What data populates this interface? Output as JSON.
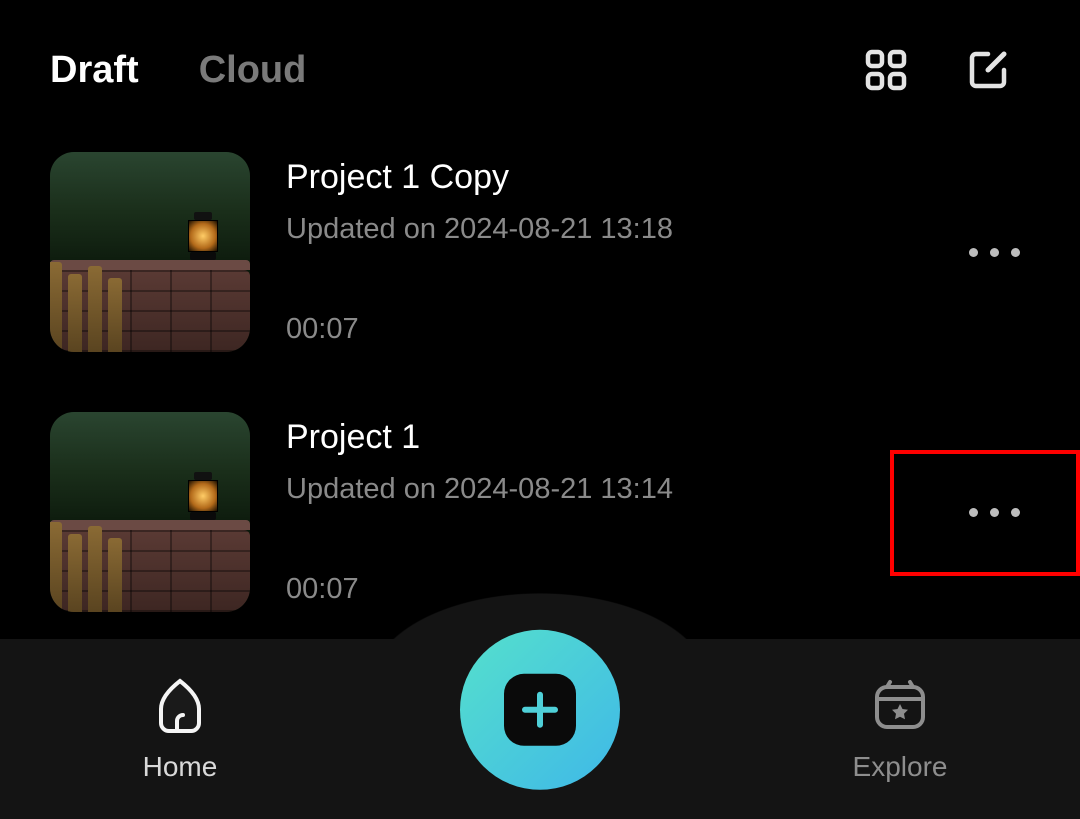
{
  "header": {
    "tabs": {
      "draft": "Draft",
      "cloud": "Cloud"
    }
  },
  "projects": [
    {
      "title": "Project 1 Copy",
      "subtitle": "Updated on 2024-08-21 13:18",
      "duration": "00:07"
    },
    {
      "title": "Project 1",
      "subtitle": "Updated on 2024-08-21 13:14",
      "duration": "00:07"
    }
  ],
  "nav": {
    "home": "Home",
    "explore": "Explore"
  }
}
